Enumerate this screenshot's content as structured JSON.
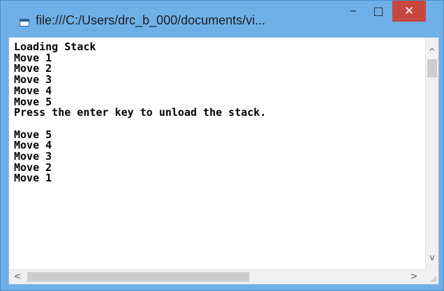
{
  "window": {
    "title": "file:///C:/Users/drc_b_000/documents/vi...",
    "minimize_label": "–",
    "maximize_label": "□",
    "close_label": "✕",
    "accent": "#6fb0e8",
    "close_color": "#c7463f"
  },
  "console": {
    "lines": [
      "Loading Stack",
      "Move 1",
      "Move 2",
      "Move 3",
      "Move 4",
      "Move 5",
      "Press the enter key to unload the stack.",
      "",
      "Move 5",
      "Move 4",
      "Move 3",
      "Move 2",
      "Move 1"
    ]
  },
  "scrollbars": {
    "up_arrow": "^",
    "down_arrow": "v",
    "left_arrow": "<",
    "right_arrow": ">"
  },
  "icons": {
    "app": "console-window-icon"
  }
}
